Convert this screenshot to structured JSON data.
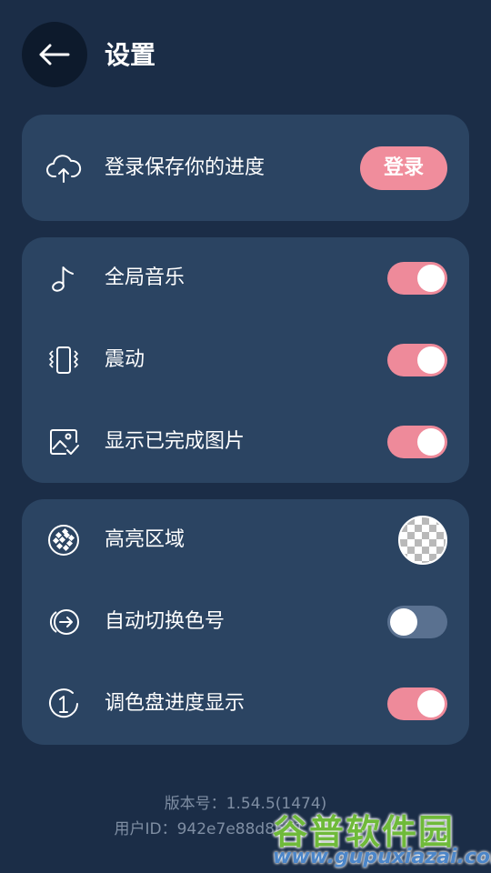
{
  "header": {
    "title": "设置",
    "back_icon": "arrow-left-icon"
  },
  "account": {
    "label": "登录保存你的进度",
    "icon": "cloud-upload-icon",
    "login_label": "登录"
  },
  "preferences": [
    {
      "label": "全局音乐",
      "icon": "music-note-icon",
      "enabled": true
    },
    {
      "label": "震动",
      "icon": "vibration-icon",
      "enabled": true
    },
    {
      "label": "显示已完成图片",
      "icon": "image-check-icon",
      "enabled": true
    }
  ],
  "display": {
    "highlight_label": "高亮区域",
    "highlight_icon": "pattern-dots-icon",
    "auto_switch_label": "自动切换色号",
    "auto_switch_enabled": false,
    "palette_progress_label": "调色盘进度显示",
    "palette_progress_enabled": true
  },
  "footer": {
    "version": "版本号：1.54.5(1474)",
    "user_id": "用户ID：942e7e88d8621"
  },
  "watermark": {
    "cn": "谷普软件园",
    "en": "www.gupuxiazai.com"
  },
  "colors": {
    "background": "#1b2d47",
    "card": "#2b4462",
    "accent": "#ee8a9a",
    "toggle_off": "#5a7190"
  }
}
